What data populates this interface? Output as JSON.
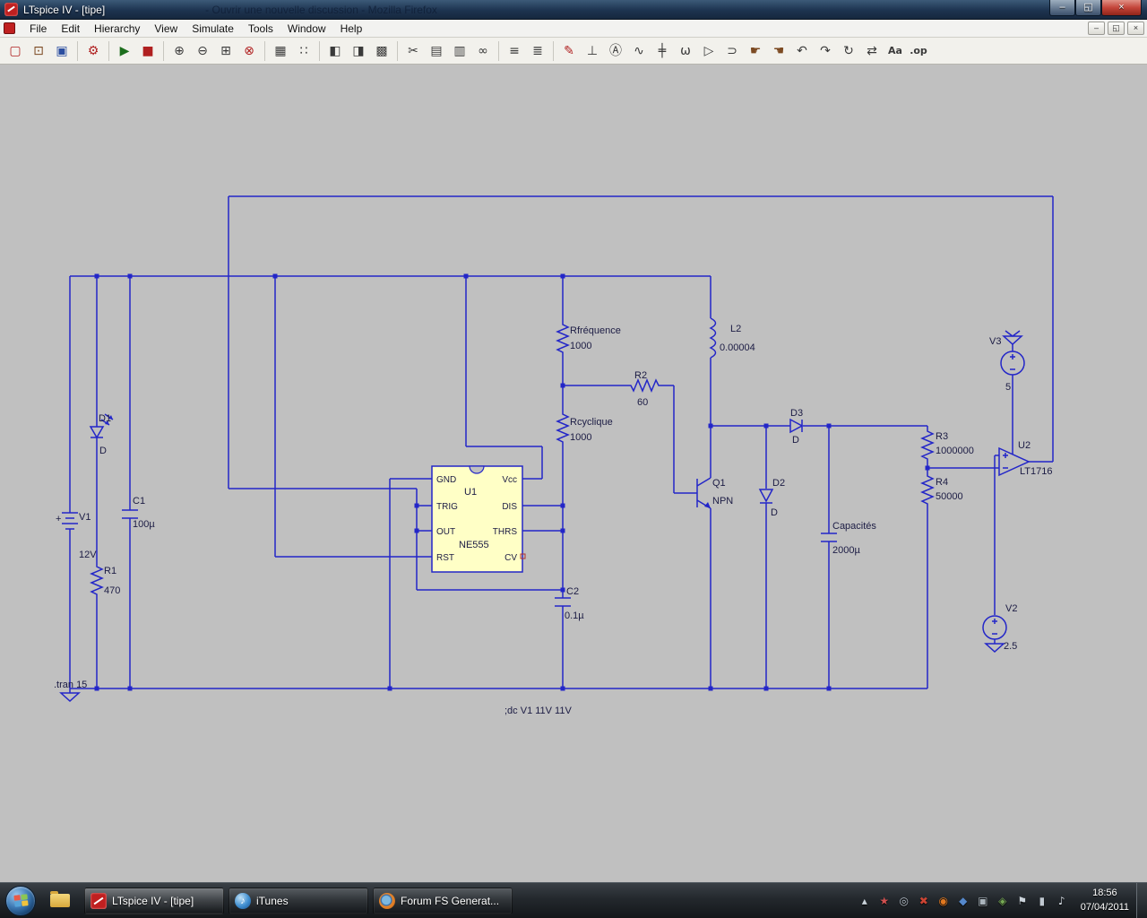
{
  "window": {
    "title": "LTspice IV - [tipe]",
    "ghost_text": "- Ouvrir une nouvelle discussion - Mozilla Firefox",
    "controls": {
      "minimize": "–",
      "restore": "◱",
      "close": "×"
    }
  },
  "menu": {
    "items": [
      "File",
      "Edit",
      "Hierarchy",
      "View",
      "Simulate",
      "Tools",
      "Window",
      "Help"
    ]
  },
  "mdi": {
    "minimize": "–",
    "restore": "◱",
    "close": "×"
  },
  "toolbar": {
    "buttons": [
      {
        "name": "new-schematic",
        "glyph": "▢"
      },
      {
        "name": "open",
        "glyph": "⊡"
      },
      {
        "name": "save",
        "glyph": "▣"
      },
      {
        "name": "control-panel",
        "glyph": "⚙"
      },
      {
        "name": "run",
        "glyph": "▶"
      },
      {
        "name": "halt",
        "glyph": "■"
      },
      {
        "name": "zoom-in",
        "glyph": "⊕"
      },
      {
        "name": "zoom-back",
        "glyph": "⊖"
      },
      {
        "name": "zoom-fit",
        "glyph": "⊞"
      },
      {
        "name": "zoom-out",
        "glyph": "⊗"
      },
      {
        "name": "grid",
        "glyph": "▦"
      },
      {
        "name": "mark-datapoints",
        "glyph": "∷"
      },
      {
        "name": "tile-horizontal",
        "glyph": "◧"
      },
      {
        "name": "tile-vertical",
        "glyph": "◨"
      },
      {
        "name": "cascade-windows",
        "glyph": "▩"
      },
      {
        "name": "cut",
        "glyph": "✂"
      },
      {
        "name": "copy",
        "glyph": "▤"
      },
      {
        "name": "paste",
        "glyph": "▥"
      },
      {
        "name": "find",
        "glyph": "∞"
      },
      {
        "name": "print-preview",
        "glyph": "≡"
      },
      {
        "name": "print",
        "glyph": "≣"
      },
      {
        "name": "wire",
        "glyph": "✎"
      },
      {
        "name": "ground",
        "glyph": "⊥"
      },
      {
        "name": "net-label",
        "glyph": "Ⓐ"
      },
      {
        "name": "resistor",
        "glyph": "∿"
      },
      {
        "name": "capacitor",
        "glyph": "╪"
      },
      {
        "name": "inductor",
        "glyph": "ω"
      },
      {
        "name": "diode",
        "glyph": "▷"
      },
      {
        "name": "component",
        "glyph": "⊃"
      },
      {
        "name": "move",
        "glyph": "☛"
      },
      {
        "name": "drag",
        "glyph": "☚"
      },
      {
        "name": "undo",
        "glyph": "↶"
      },
      {
        "name": "redo",
        "glyph": "↷"
      },
      {
        "name": "rotate",
        "glyph": "↻"
      },
      {
        "name": "mirror",
        "glyph": "⇄"
      },
      {
        "name": "text",
        "glyph": "Aa"
      },
      {
        "name": "spice-directive",
        "glyph": ".op"
      }
    ]
  },
  "schematic": {
    "v1": {
      "ref": "V1",
      "value": "12V",
      "plus": "+"
    },
    "d1": {
      "ref": "D1",
      "value": "D"
    },
    "c1": {
      "ref": "C1",
      "value": "100µ"
    },
    "r1": {
      "ref": "R1",
      "value": "470"
    },
    "rfreq": {
      "ref": "Rfréquence",
      "value": "1000"
    },
    "rcyc": {
      "ref": "Rcyclique",
      "value": "1000"
    },
    "r2": {
      "ref": "R2",
      "value": "60"
    },
    "l2": {
      "ref": "L2",
      "value": "0.00004"
    },
    "u1": {
      "ref": "U1",
      "part": "NE555",
      "pins_left": [
        "GND",
        "TRIG",
        "OUT",
        "RST"
      ],
      "pins_right": [
        "Vcc",
        "DIS",
        "THRS",
        "CV"
      ]
    },
    "c2": {
      "ref": "C2",
      "value": "0.1µ"
    },
    "q1": {
      "ref": "Q1",
      "value": "NPN"
    },
    "d3": {
      "ref": "D3",
      "value": "D"
    },
    "d2": {
      "ref": "D2",
      "value": "D"
    },
    "cout": {
      "ref": "Capacités",
      "value": "2000µ"
    },
    "r3": {
      "ref": "R3",
      "value": "1000000"
    },
    "r4": {
      "ref": "R4",
      "value": "50000"
    },
    "u2": {
      "ref": "U2",
      "part": "LT1716"
    },
    "v3": {
      "ref": "V3",
      "value": "5"
    },
    "v2": {
      "ref": "V2",
      "value": "2.5"
    },
    "directives": {
      "tran": ".tran 15",
      "dc": ";dc V1 11V 11V"
    },
    "colors": {
      "wire": "#2326c8",
      "canvas": "#c0c0c0",
      "ic_fill": "#ffffc6"
    }
  },
  "taskbar": {
    "tasks": [
      {
        "label": "LTspice IV - [tipe]"
      },
      {
        "label": "iTunes",
        "icon_glyph": "♪"
      },
      {
        "label": "Forum FS Generat..."
      }
    ],
    "tray": [
      {
        "glyph": "▴",
        "style": "color:#c9d2da"
      },
      {
        "glyph": "★",
        "style": "color:#d05050"
      },
      {
        "glyph": "◎",
        "style": "color:#b8c2cc"
      },
      {
        "glyph": "✖",
        "style": "color:#cc4433"
      },
      {
        "glyph": "◉",
        "style": "color:#e07820"
      },
      {
        "glyph": "◆",
        "style": "color:#5588cc"
      },
      {
        "glyph": "▣",
        "style": "color:#aab4bc"
      },
      {
        "glyph": "◈",
        "style": "color:#77aa55"
      },
      {
        "glyph": "⚑",
        "style": "color:#ccd4dc"
      },
      {
        "glyph": "▮",
        "style": "color:#c0c8d0"
      },
      {
        "glyph": "♪",
        "style": "color:#d7dee5"
      }
    ],
    "clock": {
      "time": "18:56",
      "date": "07/04/2011"
    }
  }
}
